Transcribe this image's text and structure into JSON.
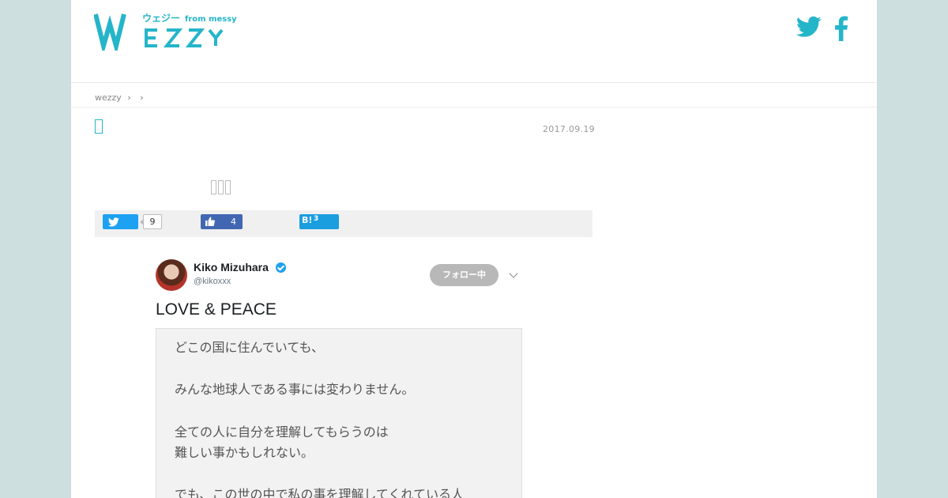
{
  "header": {
    "logo_main": "WEZZY",
    "logo_sub": "ウェジー",
    "logo_from": "from messy",
    "twitter_icon": "twitter-icon",
    "facebook_icon": "facebook-icon",
    "accent_color": "#25b5c9"
  },
  "breadcrumb": {
    "home": "wezzy",
    "sep1": "›",
    "sep2": "›"
  },
  "article": {
    "date": "2017.09.19"
  },
  "share": {
    "twitter_count": "9",
    "facebook_count": "4",
    "hatena_label": "B!",
    "hatena_count": "3"
  },
  "tweet": {
    "name": "Kiko Mizuhara",
    "handle": "@kikoxxx",
    "follow_label": "フォロー中",
    "text": "LOVE & PEACE",
    "image_lines": [
      "どこの国に住んでいても、",
      "みんな地球人である事には変わりません。",
      "全ての人に自分を理解してもらうのは",
      "難しい事かもしれない。",
      "でも、この世の中で私の事を理解してくれている人"
    ]
  }
}
